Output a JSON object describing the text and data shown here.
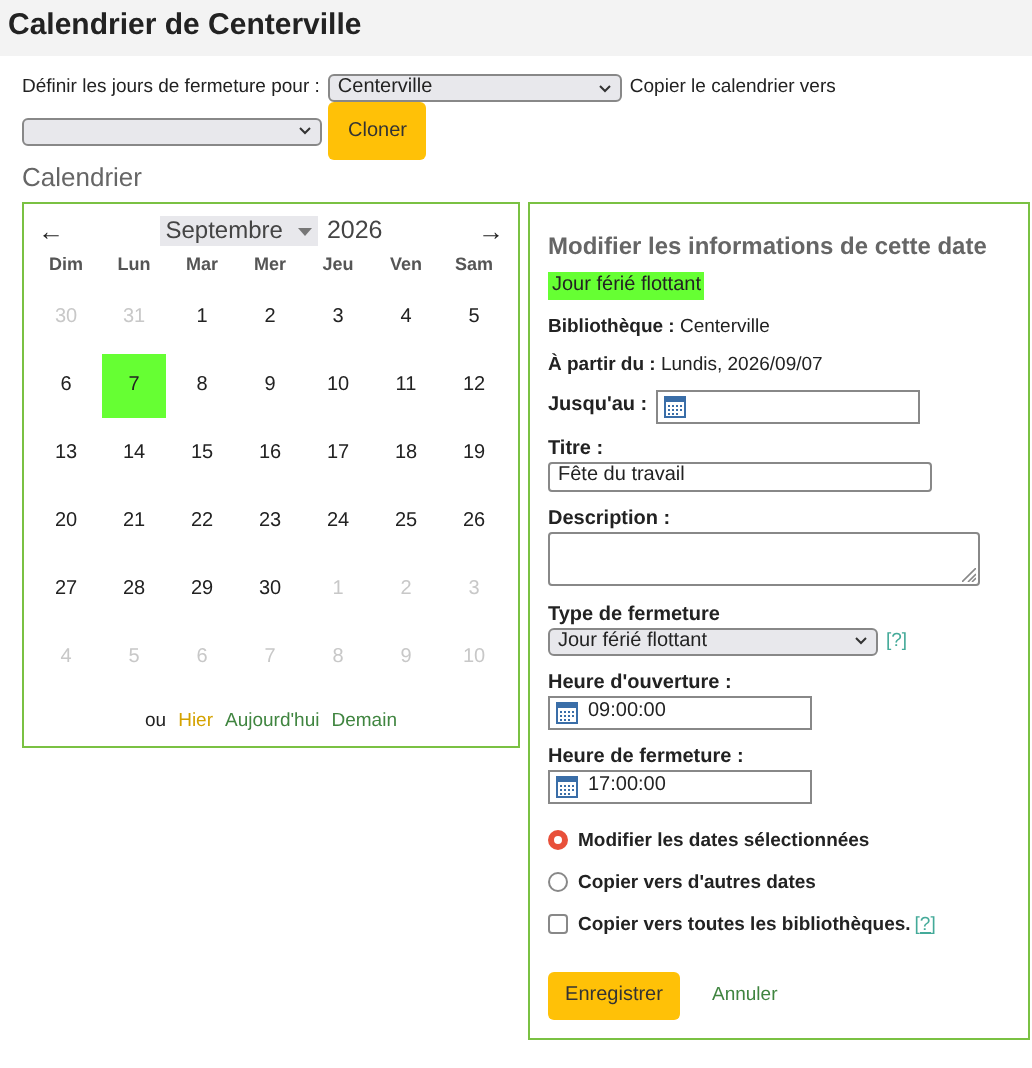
{
  "page_title": "Calendrier de Centerville",
  "toolbar": {
    "define_label": "Définir les jours de fermeture pour :",
    "library_select": "Centerville",
    "copy_label": "Copier le calendrier vers",
    "clone_button": "Cloner"
  },
  "section_title": "Calendrier",
  "calendar": {
    "prev": "←",
    "month": "Septembre",
    "year": "2026",
    "next": "→",
    "weekdays": [
      "Dim",
      "Lun",
      "Mar",
      "Mer",
      "Jeu",
      "Ven",
      "Sam"
    ],
    "weeks": [
      [
        {
          "day": "30",
          "muted": true,
          "selected": false
        },
        {
          "day": "31",
          "muted": true,
          "selected": false
        },
        {
          "day": "1",
          "muted": false,
          "selected": false
        },
        {
          "day": "2",
          "muted": false,
          "selected": false
        },
        {
          "day": "3",
          "muted": false,
          "selected": false
        },
        {
          "day": "4",
          "muted": false,
          "selected": false
        },
        {
          "day": "5",
          "muted": false,
          "selected": false
        }
      ],
      [
        {
          "day": "6",
          "muted": false,
          "selected": false
        },
        {
          "day": "7",
          "muted": false,
          "selected": true
        },
        {
          "day": "8",
          "muted": false,
          "selected": false
        },
        {
          "day": "9",
          "muted": false,
          "selected": false
        },
        {
          "day": "10",
          "muted": false,
          "selected": false
        },
        {
          "day": "11",
          "muted": false,
          "selected": false
        },
        {
          "day": "12",
          "muted": false,
          "selected": false
        }
      ],
      [
        {
          "day": "13",
          "muted": false,
          "selected": false
        },
        {
          "day": "14",
          "muted": false,
          "selected": false
        },
        {
          "day": "15",
          "muted": false,
          "selected": false
        },
        {
          "day": "16",
          "muted": false,
          "selected": false
        },
        {
          "day": "17",
          "muted": false,
          "selected": false
        },
        {
          "day": "18",
          "muted": false,
          "selected": false
        },
        {
          "day": "19",
          "muted": false,
          "selected": false
        }
      ],
      [
        {
          "day": "20",
          "muted": false,
          "selected": false
        },
        {
          "day": "21",
          "muted": false,
          "selected": false
        },
        {
          "day": "22",
          "muted": false,
          "selected": false
        },
        {
          "day": "23",
          "muted": false,
          "selected": false
        },
        {
          "day": "24",
          "muted": false,
          "selected": false
        },
        {
          "day": "25",
          "muted": false,
          "selected": false
        },
        {
          "day": "26",
          "muted": false,
          "selected": false
        }
      ],
      [
        {
          "day": "27",
          "muted": false,
          "selected": false
        },
        {
          "day": "28",
          "muted": false,
          "selected": false
        },
        {
          "day": "29",
          "muted": false,
          "selected": false
        },
        {
          "day": "30",
          "muted": false,
          "selected": false
        },
        {
          "day": "1",
          "muted": true,
          "selected": false
        },
        {
          "day": "2",
          "muted": true,
          "selected": false
        },
        {
          "day": "3",
          "muted": true,
          "selected": false
        }
      ],
      [
        {
          "day": "4",
          "muted": true,
          "selected": false
        },
        {
          "day": "5",
          "muted": true,
          "selected": false
        },
        {
          "day": "6",
          "muted": true,
          "selected": false
        },
        {
          "day": "7",
          "muted": true,
          "selected": false
        },
        {
          "day": "8",
          "muted": true,
          "selected": false
        },
        {
          "day": "9",
          "muted": true,
          "selected": false
        },
        {
          "day": "10",
          "muted": true,
          "selected": false
        }
      ]
    ],
    "footer_text": "ou",
    "footer_links": [
      {
        "label": "Hier",
        "color": "#d4a200"
      },
      {
        "label": "Aujourd'hui",
        "color": "#408540"
      },
      {
        "label": "Demain",
        "color": "#408540"
      }
    ]
  },
  "form": {
    "title": "Modifier les informations de cette date",
    "badge": "Jour férié flottant",
    "info": [
      {
        "label": "Bibliothèque :",
        "value": "Centerville"
      },
      {
        "label": "À partir du :",
        "value": "Lundis, 2026/09/07"
      }
    ],
    "until_label": "Jusqu'au :",
    "title_label": "Titre :",
    "title_value": "Fête du travail",
    "description_label": "Description :",
    "type_label": "Type de fermeture",
    "type_value": "Jour férié flottant",
    "type_help": "[?]",
    "open_label": "Heure d'ouverture :",
    "open_value": "09:00:00",
    "close_label": "Heure de fermeture :",
    "close_value": "17:00:00",
    "options": [
      {
        "kind": "radio",
        "label": "Modifier les dates sélectionnées",
        "selected": true
      },
      {
        "kind": "radio",
        "label": "Copier vers d'autres dates",
        "selected": false
      },
      {
        "kind": "checkbox",
        "label": "Copier vers toutes les bibliothèques.",
        "checked": false,
        "help": "[?]"
      }
    ],
    "save_button": "Enregistrer",
    "cancel_link": "Annuler"
  }
}
